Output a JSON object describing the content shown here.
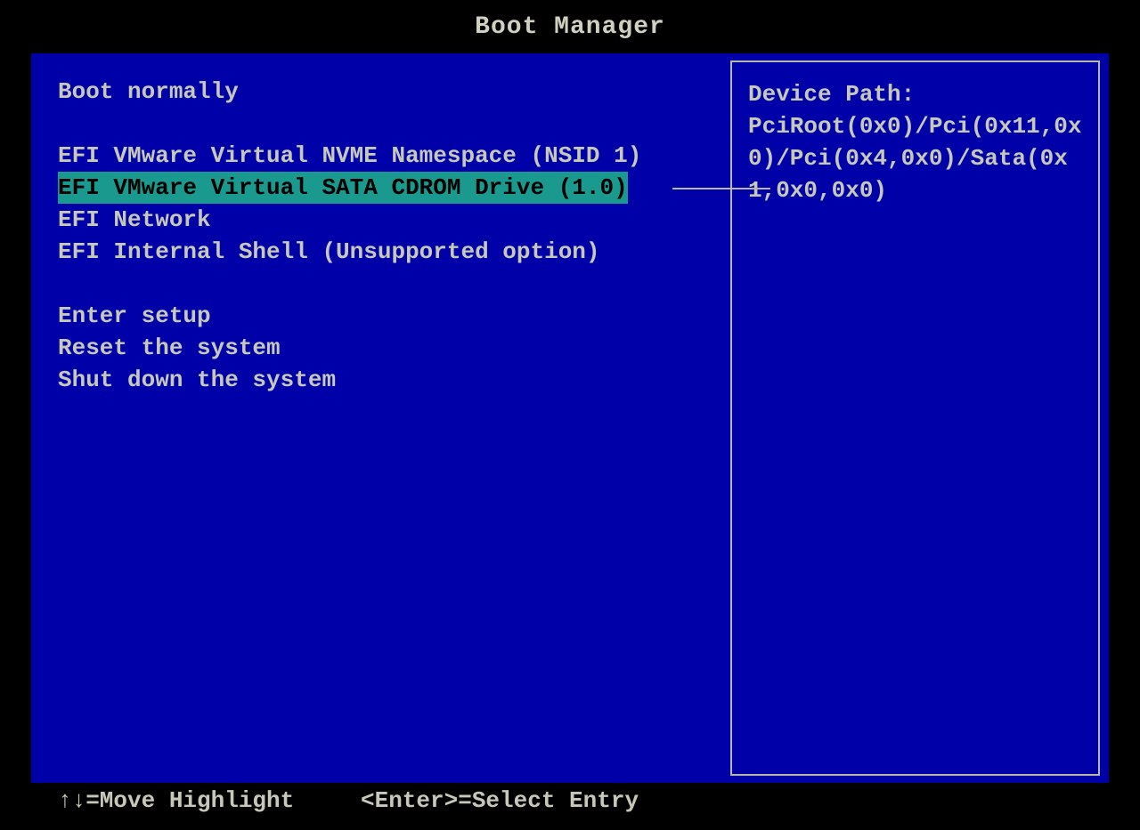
{
  "title": "Boot Manager",
  "menu": {
    "group1": [
      "Boot normally"
    ],
    "group2": [
      "EFI VMware Virtual NVME Namespace (NSID 1)",
      "EFI VMware Virtual SATA CDROM Drive (1.0)",
      "EFI Network",
      "EFI Internal Shell (Unsupported option)"
    ],
    "group3": [
      "Enter setup",
      "Reset the system",
      "Shut down the system"
    ],
    "selected_text": "EFI VMware Virtual SATA CDROM Drive (1.0)"
  },
  "info_panel": {
    "label": "Device Path:",
    "value": "PciRoot(0x0)/Pci(0x11,0x0)/Pci(0x4,0x0)/Sata(0x1,0x0,0x0)"
  },
  "footer": {
    "move": "↑↓=Move Highlight",
    "select": "<Enter>=Select Entry"
  }
}
